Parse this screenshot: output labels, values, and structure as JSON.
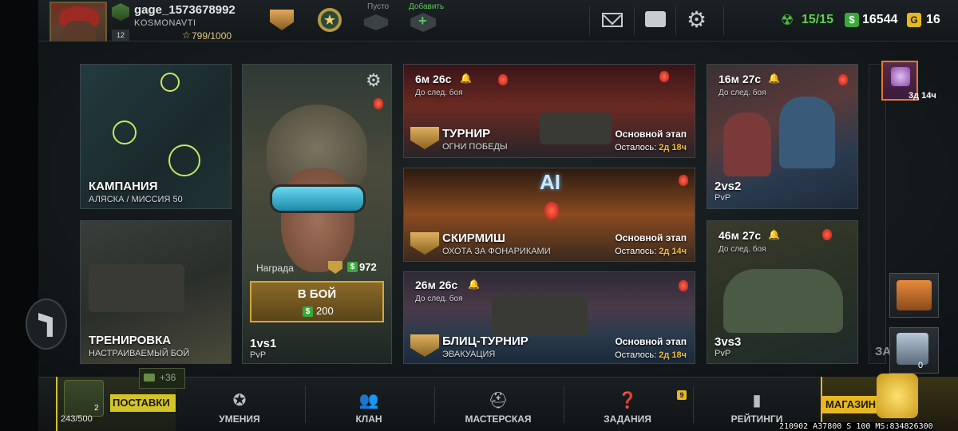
{
  "player": {
    "name": "gage_1573678992",
    "clan": "KOSMONAVTI",
    "level": "12",
    "xp_text": "799/1000",
    "xp_fraction": 0.799
  },
  "topbar": {
    "slot_empty_label": "Пусто",
    "slot_add_label": "Добавить",
    "energy": "15/15",
    "cash": "16544",
    "gold": "16",
    "energy_color": "#5ed04a",
    "gold_color": "#e8b820"
  },
  "cards": {
    "campaign": {
      "title": "КАМПАНИЯ",
      "sub": "АЛЯСКА / МИССИЯ 50"
    },
    "training": {
      "title": "ТРЕНИРОВКА",
      "sub": "НАСТРАИВАЕМЫЙ БОЙ"
    },
    "pvp1": {
      "title": "1vs1",
      "sub": "PvP",
      "reward_label": "Награда",
      "reward_value": "972",
      "battle_label": "В БОЙ",
      "battle_cost": "200"
    },
    "tournament": {
      "timer": "6м 26с",
      "timer_sub": "До след. боя",
      "title": "ТУРНИР",
      "sub": "ОГНИ ПОБЕДЫ",
      "stage": "Основной этап",
      "remain_label": "Осталось:",
      "remain_value": "2д 18ч"
    },
    "skirmish": {
      "title": "СКИРМИШ",
      "sub": "ОХОТА ЗА ФОНАРИКАМИ",
      "stage": "Основной этап",
      "remain_label": "Осталось:",
      "remain_value": "2д 14ч",
      "banner": "AI"
    },
    "blitz": {
      "timer": "26м 26с",
      "timer_sub": "До след. боя",
      "title": "БЛИЦ-ТУРНИР",
      "sub": "ЭВАКУАЦИЯ",
      "stage": "Основной этап",
      "remain_label": "Осталось:",
      "remain_value": "2д 18ч"
    },
    "pvp2": {
      "timer": "16м 27с",
      "timer_sub": "До след. боя",
      "title": "2vs2",
      "sub": "PvP"
    },
    "pvp3": {
      "timer": "46м 27с",
      "timer_sub": "До след. боя",
      "title": "3vs3",
      "sub": "PvP"
    }
  },
  "side": {
    "event_timer": "3д 14ч",
    "steel_crate_count": "0",
    "partial_label": "ЗА"
  },
  "bottom": {
    "supplies_label": "ПОСТАВКИ",
    "supplies_count": "243/500",
    "supplies_crate_count": "2",
    "supplies_plus": "+36",
    "nav": [
      {
        "label": "УМЕНИЯ",
        "icon": "star-shield-icon"
      },
      {
        "label": "КЛАН",
        "icon": "people-icon"
      },
      {
        "label": "МАСТЕРСКАЯ",
        "icon": "helmet-icon"
      },
      {
        "label": "ЗАДАНИЯ",
        "icon": "question-icon"
      },
      {
        "label": "РЕЙТИНГИ",
        "icon": "bar-chart-icon"
      }
    ],
    "quests_badge": "9",
    "shop_label": "МАГАЗИН",
    "debug": "210902 A37800 S 100 MS:834826300"
  }
}
